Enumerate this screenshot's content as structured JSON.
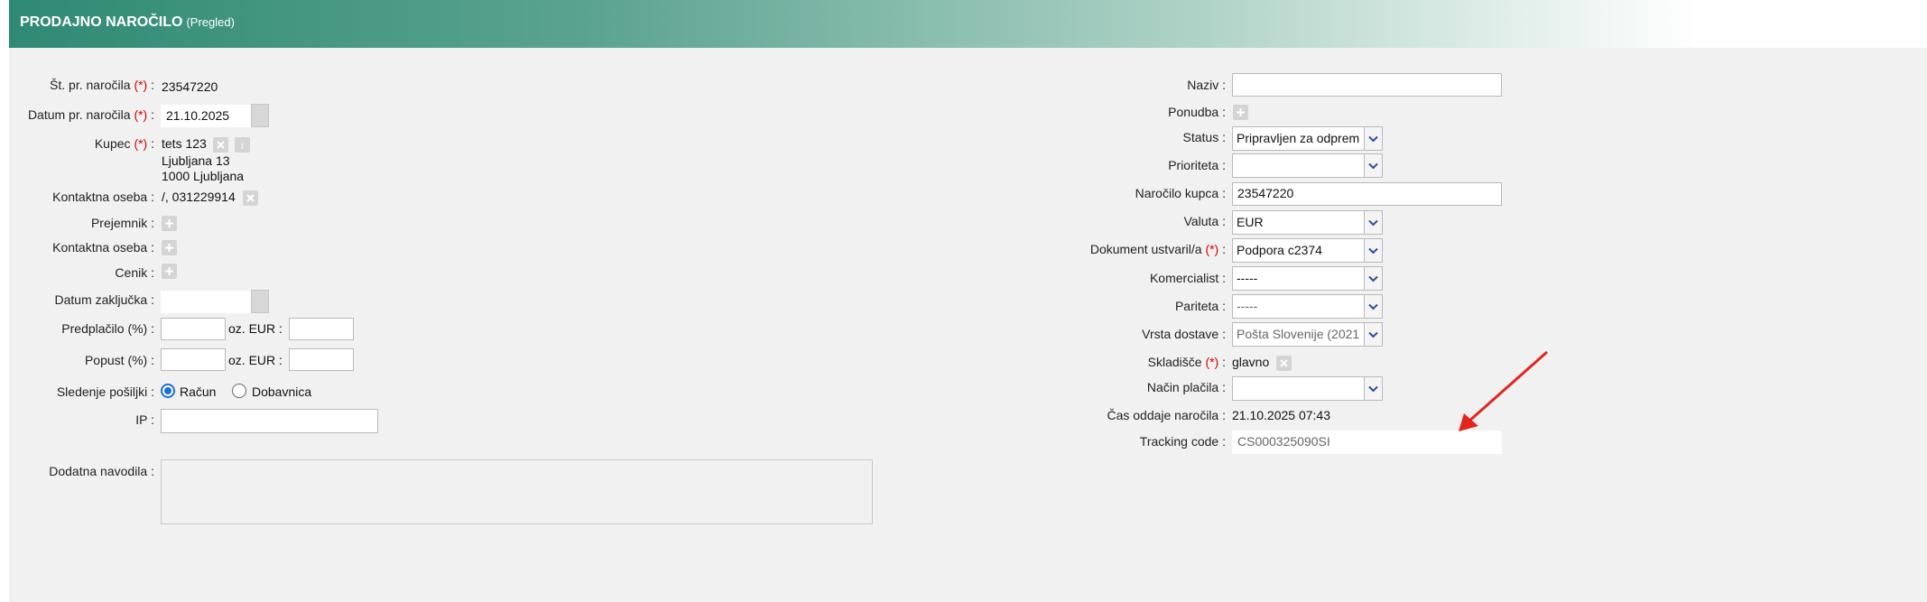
{
  "header": {
    "title": "PRODAJNO NAROČILO",
    "subtitle": "(Pregled)"
  },
  "left": {
    "order_no": {
      "label": "Št. pr. naročila",
      "req": "(*)",
      "suffix": ":",
      "value": "23547220"
    },
    "order_date": {
      "label": "Datum pr. naročila",
      "req": "(*)",
      "suffix": ":",
      "value": "21.10.2025"
    },
    "buyer": {
      "label": "Kupec",
      "req": "(*)",
      "suffix": ":",
      "name": "tets 123",
      "street": "Ljubljana 13",
      "city": "1000 Ljubljana"
    },
    "contact": {
      "label": "Kontaktna oseba :",
      "value": "/, 031229914"
    },
    "recipient": {
      "label": "Prejemnik :"
    },
    "contact2": {
      "label": "Kontaktna oseba :"
    },
    "pricelist": {
      "label": "Cenik :"
    },
    "close_date": {
      "label": "Datum zaključka :",
      "value": ""
    },
    "prepayment": {
      "label": "Predplačilo (%) :",
      "mid_label": "oz. EUR :",
      "pct": "",
      "eur": ""
    },
    "discount": {
      "label": "Popust (%) :",
      "mid_label": "oz. EUR :",
      "pct": "",
      "eur": ""
    },
    "tracking": {
      "label": "Sledenje pošiljki :",
      "options": [
        "Račun",
        "Dobavnica"
      ],
      "selected": "Račun"
    },
    "ip": {
      "label": "IP :",
      "value": ""
    },
    "notes": {
      "label": "Dodatna navodila :",
      "value": ""
    }
  },
  "right": {
    "name": {
      "label": "Naziv :",
      "value": ""
    },
    "offer": {
      "label": "Ponudba :"
    },
    "status": {
      "label": "Status :",
      "value": "Pripravljen za odprem"
    },
    "priority": {
      "label": "Prioriteta :",
      "value": ""
    },
    "customer_order": {
      "label": "Naročilo kupca :",
      "value": "23547220"
    },
    "currency": {
      "label": "Valuta :",
      "value": "EUR"
    },
    "created_by": {
      "label": "Dokument ustvaril/a",
      "req": "(*)",
      "suffix": ":",
      "value": "Podpora c2374"
    },
    "commercialist": {
      "label": "Komercialist :",
      "value": "-----"
    },
    "parity": {
      "label": "Pariteta :",
      "value": "-----"
    },
    "delivery_type": {
      "label": "Vrsta dostave :",
      "value": "Pošta Slovenije (2021"
    },
    "warehouse": {
      "label": "Skladišče",
      "req": "(*)",
      "suffix": ":",
      "value": "glavno"
    },
    "payment_method": {
      "label": "Način plačila :",
      "value": ""
    },
    "submit_time": {
      "label": "Čas oddaje naročila :",
      "value": "21.10.2025 07:43"
    },
    "tracking_code": {
      "label": "Tracking code :",
      "value": "CS000325090SI"
    }
  },
  "colors": {
    "header_start": "#2f8a73",
    "required": "#d40000",
    "radio_accent": "#1a6fd6",
    "annotation_arrow": "#e0261f"
  }
}
